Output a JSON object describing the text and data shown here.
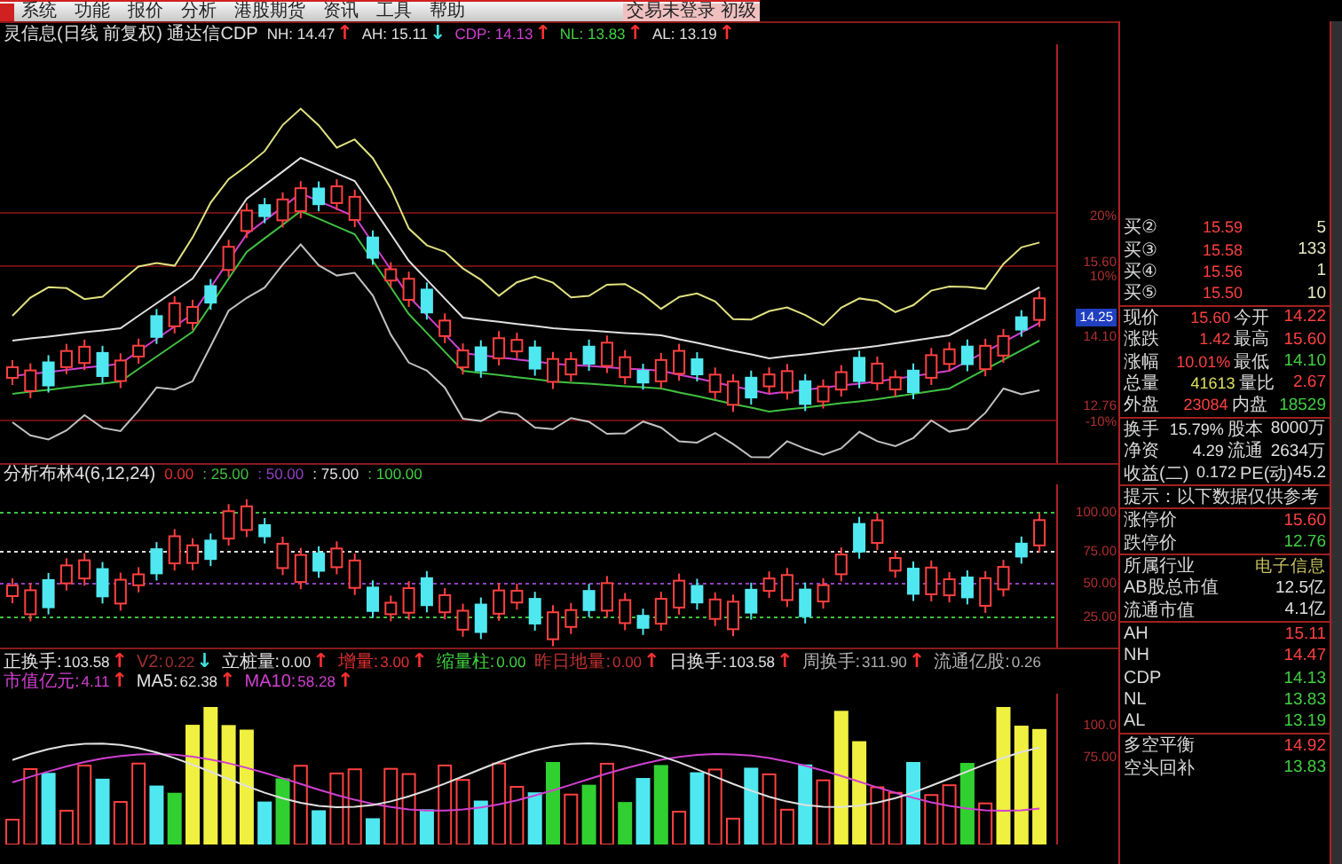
{
  "menu": {
    "items": [
      "系统",
      "功能",
      "报价",
      "分析",
      "港股期货",
      "资讯",
      "工具",
      "帮助"
    ],
    "right_text": "交易未登录 初级"
  },
  "main_pane": {
    "title": "灵信息(日线 前复权) 通达信CDP",
    "indicators": [
      {
        "name": "NH:",
        "value": "14.47",
        "color": "#e0e0e0",
        "arrow": {
          "glyph": "↑",
          "color": "#ff3030"
        }
      },
      {
        "name": "AH:",
        "value": "15.11",
        "color": "#e0e0e0",
        "arrow": {
          "glyph": "↓",
          "color": "#40e0e0"
        }
      },
      {
        "name": "CDP:",
        "value": "14.13",
        "color": "#d040d0",
        "arrow": {
          "glyph": "↑",
          "color": "#ff3030"
        }
      },
      {
        "name": "NL:",
        "value": "13.83",
        "color": "#40d040",
        "arrow": {
          "glyph": "↑",
          "color": "#ff3030"
        }
      },
      {
        "name": "AL:",
        "value": "13.19",
        "color": "#e0e0e0",
        "arrow": {
          "glyph": "↑",
          "color": "#ff3030"
        }
      }
    ],
    "axis_labels": [
      {
        "text": "20%",
        "kind": "plain"
      },
      {
        "text": "15.60",
        "kind": "plain"
      },
      {
        "text": "10%",
        "kind": "plain"
      },
      {
        "text": "14.25",
        "kind": "current"
      },
      {
        "text": "14.10",
        "kind": "plain"
      },
      {
        "text": "12.76",
        "kind": "plain"
      },
      {
        "text": "-10%",
        "kind": "plain"
      }
    ]
  },
  "mid_pane": {
    "title": "分析布林4(6,12,24)",
    "levels": [
      {
        "text": "0.00",
        "color": "#e03030"
      },
      {
        "text": ": 25.00",
        "color": "#40c040"
      },
      {
        "text": ": 50.00",
        "color": "#9040c0"
      },
      {
        "text": ": 75.00",
        "color": "#e0e0e0"
      },
      {
        "text": ": 100.00",
        "color": "#40d040"
      }
    ],
    "axis_labels": [
      "100.00",
      "75.00",
      "50.00",
      "25.00"
    ]
  },
  "volume_pane": {
    "indicators": [
      {
        "name": "正换手:",
        "value": "103.58",
        "color": "#e0e0e0",
        "arrow": {
          "glyph": "↑",
          "color": "#ff3030"
        }
      },
      {
        "name": "V2:",
        "value": "0.22",
        "color": "#a03030",
        "arrow": {
          "glyph": "↓",
          "color": "#40e0e0"
        }
      },
      {
        "name": "立桩量:",
        "value": "0.00",
        "color": "#e0e0e0",
        "arrow": {
          "glyph": "↑",
          "color": "#ff3030"
        }
      },
      {
        "name": "增量:",
        "value": "3.00",
        "color": "#e03030",
        "arrow": {
          "glyph": "↑",
          "color": "#ff3030"
        }
      },
      {
        "name": "缩量柱:",
        "value": "0.00",
        "color": "#40d040"
      },
      {
        "name": "昨日地量:",
        "value": "0.00",
        "color": "#c03030",
        "arrow": {
          "glyph": "↑",
          "color": "#ff3030"
        }
      },
      {
        "name": "日换手:",
        "value": "103.58",
        "color": "#e0e0e0",
        "arrow": {
          "glyph": "↑",
          "color": "#ff3030"
        }
      },
      {
        "name": "周换手:",
        "value": "311.90",
        "color": "#b0b0b0",
        "arrow": {
          "glyph": "↑",
          "color": "#ff3030"
        }
      },
      {
        "name": "流通亿股:",
        "value": "0.26",
        "color": "#b0b0b0"
      },
      {
        "name": "市值亿元:",
        "value": "4.11",
        "color": "#d040d0",
        "arrow": {
          "glyph": "↑",
          "color": "#ff3030"
        }
      },
      {
        "name": "MA5:",
        "value": "62.38",
        "color": "#e0e0e0",
        "arrow": {
          "glyph": "↑",
          "color": "#ff3030"
        }
      },
      {
        "name": "MA10:",
        "value": "58.28",
        "color": "#d040d0",
        "arrow": {
          "glyph": "↑",
          "color": "#ff3030"
        }
      }
    ],
    "axis_labels": [
      "100.0",
      "75.00"
    ]
  },
  "order_book": [
    {
      "label": "买②",
      "price": "15.59",
      "volume": "5"
    },
    {
      "label": "买③",
      "price": "15.58",
      "volume": "133"
    },
    {
      "label": "买④",
      "price": "15.56",
      "volume": "1"
    },
    {
      "label": "买⑤",
      "price": "15.50",
      "volume": "10"
    }
  ],
  "quote": [
    {
      "left": {
        "label": "现价",
        "value": "15.60",
        "color": "#ff4040"
      },
      "right": {
        "label": "今开",
        "value": "14.22",
        "color": "#ff4040"
      }
    },
    {
      "left": {
        "label": "涨跌",
        "value": "1.42",
        "color": "#ff4040"
      },
      "right": {
        "label": "最高",
        "value": "15.60",
        "color": "#ff4040"
      }
    },
    {
      "left": {
        "label": "涨幅",
        "value": "10.01%",
        "color": "#ff4040"
      },
      "right": {
        "label": "最低",
        "value": "14.10",
        "color": "#40d040"
      }
    },
    {
      "left": {
        "label": "总量",
        "value": "41613",
        "color": "#e0e060"
      },
      "right": {
        "label": "量比",
        "value": "2.67",
        "color": "#ff4040"
      }
    },
    {
      "left": {
        "label": "外盘",
        "value": "23084",
        "color": "#ff4040"
      },
      "right": {
        "label": "内盘",
        "value": "18529",
        "color": "#40d040"
      }
    },
    {
      "left": {
        "label": "换手",
        "value": "15.79%",
        "color": "#e0e0e0"
      },
      "right": {
        "label": "股本",
        "value": "8000万",
        "color": "#e0e0e0"
      }
    },
    {
      "left": {
        "label": "净资",
        "value": "4.29",
        "color": "#e0e0e0"
      },
      "right": {
        "label": "流通",
        "value": "2634万",
        "color": "#e0e0e0"
      }
    },
    {
      "left": {
        "label": "收益(二)",
        "value": "0.172",
        "color": "#e0e0e0"
      },
      "right": {
        "label": "PE(动)",
        "value": "45.2",
        "color": "#e0e0e0"
      }
    }
  ],
  "notice": "提示：以下数据仅供参考",
  "info": [
    {
      "label": "涨停价",
      "value": "15.60",
      "color": "#ff4040"
    },
    {
      "label": "跌停价",
      "value": "12.76",
      "color": "#40d040"
    },
    {
      "label": "所属行业",
      "value": "电子信息",
      "color": "#c8c060"
    },
    {
      "label": "AB股总市值",
      "value": "12.5亿",
      "color": "#e0e0e0"
    },
    {
      "label": "流通市值",
      "value": "4.1亿",
      "color": "#e0e0e0"
    },
    {
      "label": "AH",
      "value": "15.11",
      "color": "#ff4040"
    },
    {
      "label": "NH",
      "value": "14.47",
      "color": "#ff4040"
    },
    {
      "label": "CDP",
      "value": "14.13",
      "color": "#40d040"
    },
    {
      "label": "NL",
      "value": "13.83",
      "color": "#40d040"
    },
    {
      "label": "AL",
      "value": "13.19",
      "color": "#40d040"
    },
    {
      "label": "多空平衡",
      "value": "14.92",
      "color": "#ff4040"
    },
    {
      "label": "空头回补",
      "value": "13.83",
      "color": "#40d040"
    }
  ]
}
